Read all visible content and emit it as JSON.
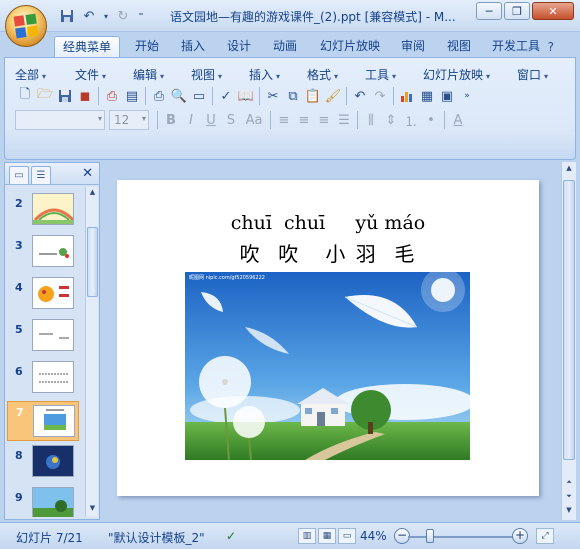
{
  "window": {
    "title": "语文园地—有趣的游戏课件_(2).ppt [兼容模式] - M..."
  },
  "tabs": [
    {
      "label": "经典菜单",
      "active": true
    },
    {
      "label": "开始"
    },
    {
      "label": "插入"
    },
    {
      "label": "设计"
    },
    {
      "label": "动画"
    },
    {
      "label": "幻灯片放映"
    },
    {
      "label": "审阅"
    },
    {
      "label": "视图"
    },
    {
      "label": "开发工具"
    }
  ],
  "menu": {
    "items": [
      "全部",
      "文件",
      "编辑",
      "视图",
      "插入",
      "格式",
      "工具",
      "幻灯片放映",
      "窗口"
    ]
  },
  "format": {
    "font_size": "12"
  },
  "thumbnails": [
    {
      "num": "2"
    },
    {
      "num": "3"
    },
    {
      "num": "4"
    },
    {
      "num": "5"
    },
    {
      "num": "6"
    },
    {
      "num": "7",
      "selected": true
    },
    {
      "num": "8"
    },
    {
      "num": "9"
    }
  ],
  "slide": {
    "pinyin": "chuī  chuī     yǔ máo",
    "hanzi": "吹  吹   小 羽  毛",
    "watermark": "昵图网 nipic.com/gf520596222"
  },
  "status": {
    "slide_counter": "幻灯片 7/21",
    "template": "\"默认设计模板_2\"",
    "zoom": "44%"
  },
  "colors": {
    "accent": "#15428b",
    "selected_thumb": "#f8c57a"
  }
}
